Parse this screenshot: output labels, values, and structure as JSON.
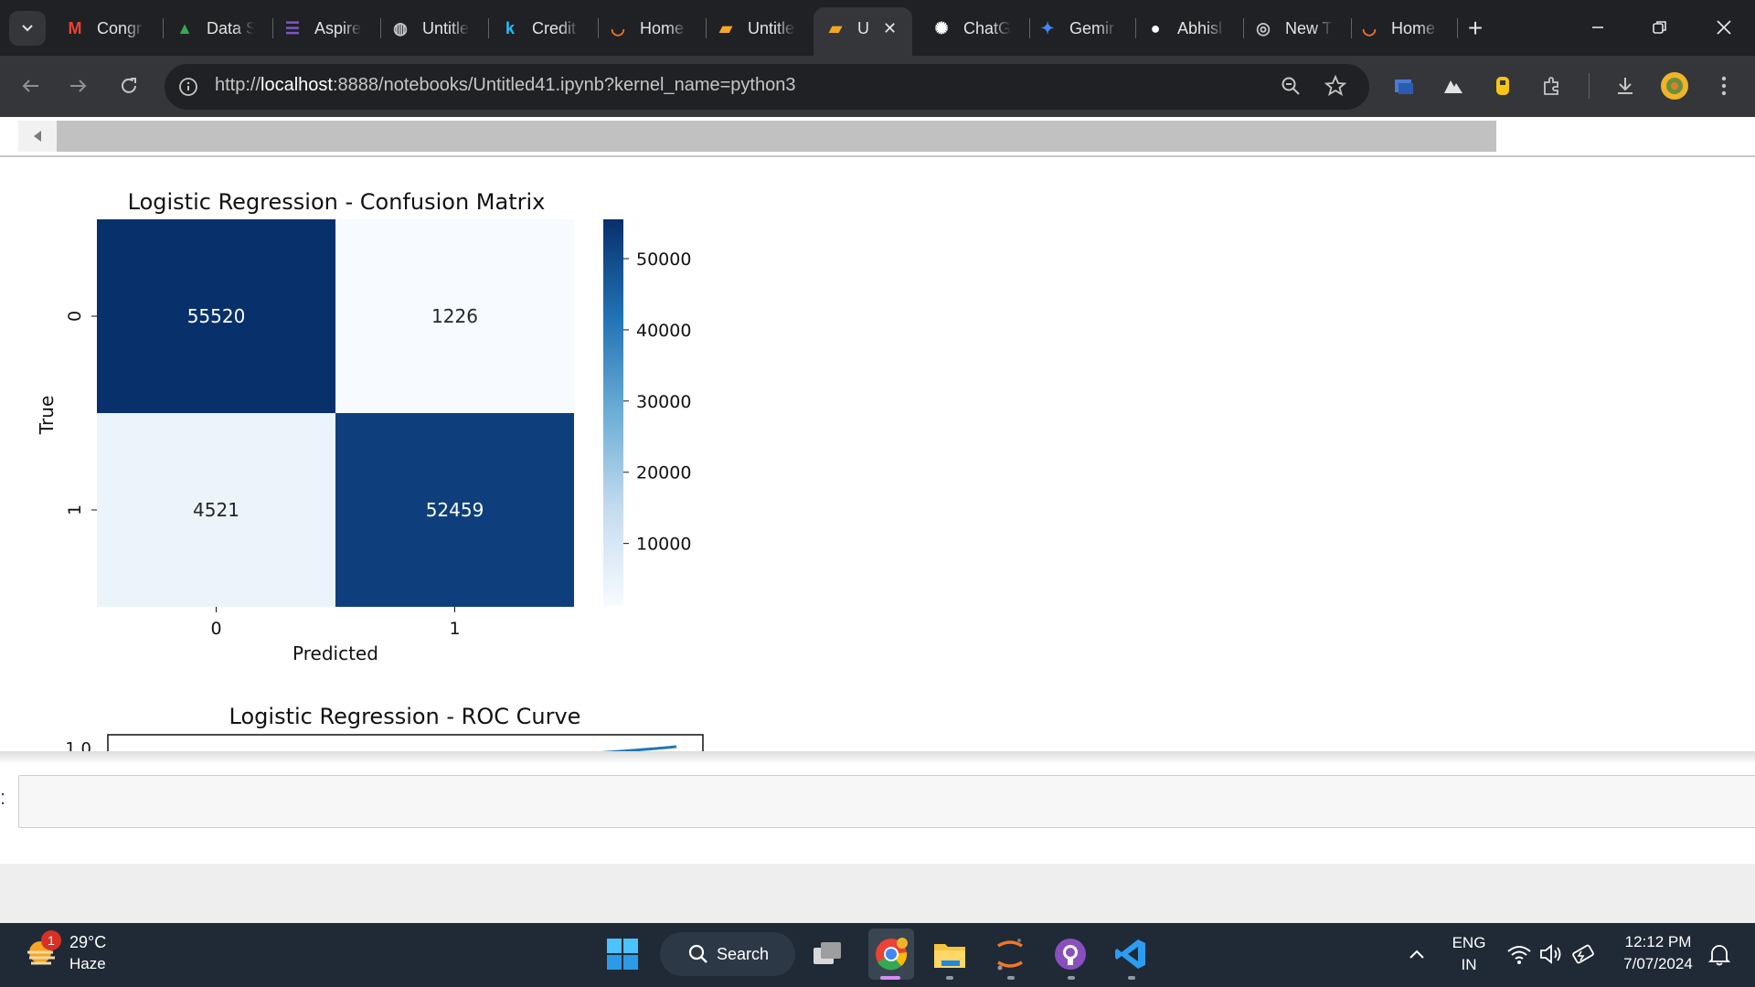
{
  "browser": {
    "tabs": [
      {
        "title": "Congr",
        "icon": "gmail-icon",
        "color": "#ea4335"
      },
      {
        "title": "Data S",
        "icon": "google-drive-icon",
        "color": "#34a853"
      },
      {
        "title": "Aspire",
        "icon": "list-app-icon",
        "color": "#7e57c2"
      },
      {
        "title": "Untitle",
        "icon": "globe-icon",
        "color": "#c4c7c5"
      },
      {
        "title": "Credit",
        "icon": "kaggle-icon",
        "color": "#20beff"
      },
      {
        "title": "Home",
        "icon": "jupyter-icon",
        "color": "#f37626"
      },
      {
        "title": "Untitle",
        "icon": "notebook-icon",
        "color": "#f5a623"
      },
      {
        "title": "U",
        "icon": "notebook-icon",
        "color": "#f5a623",
        "active": true
      },
      {
        "title": "ChatG",
        "icon": "chatgpt-icon",
        "color": "#ffffff"
      },
      {
        "title": "Gemir",
        "icon": "gemini-icon",
        "color": "#4285f4"
      },
      {
        "title": "Abhisl",
        "icon": "github-icon",
        "color": "#ffffff"
      },
      {
        "title": "New T",
        "icon": "chrome-icon",
        "color": "#c4c7c5"
      },
      {
        "title": "Home",
        "icon": "jupyter-icon",
        "color": "#f37626"
      }
    ],
    "url_prefix": "http://",
    "url_host": "localhost",
    "url_rest": ":8888/notebooks/Untitled41.ipynb?kernel_name=python3"
  },
  "chart_data": [
    {
      "type": "heatmap",
      "title": "Logistic Regression - Confusion Matrix",
      "xlabel": "Predicted",
      "ylabel": "True",
      "x_categories": [
        "0",
        "1"
      ],
      "y_categories": [
        "0",
        "1"
      ],
      "values": [
        [
          55520,
          1226
        ],
        [
          4521,
          52459
        ]
      ],
      "colormap": "Blues",
      "colorbar_ticks": [
        "50000",
        "40000",
        "30000",
        "20000",
        "10000"
      ],
      "colorbar_tick_values": [
        50000,
        40000,
        30000,
        20000,
        10000
      ],
      "colorbar_range": [
        1226,
        55520
      ]
    },
    {
      "type": "line",
      "title": "Logistic Regression - ROC Curve",
      "visible_ytick": "1.0"
    }
  ],
  "notebook": {
    "prompt_marker": ":"
  },
  "taskbar": {
    "weather_temp": "29°C",
    "weather_desc": "Haze",
    "weather_badge": "1",
    "search_label": "Search",
    "lang_top": "ENG",
    "lang_bottom": "IN",
    "time": "12:12 PM",
    "date": "7/07/2024"
  }
}
